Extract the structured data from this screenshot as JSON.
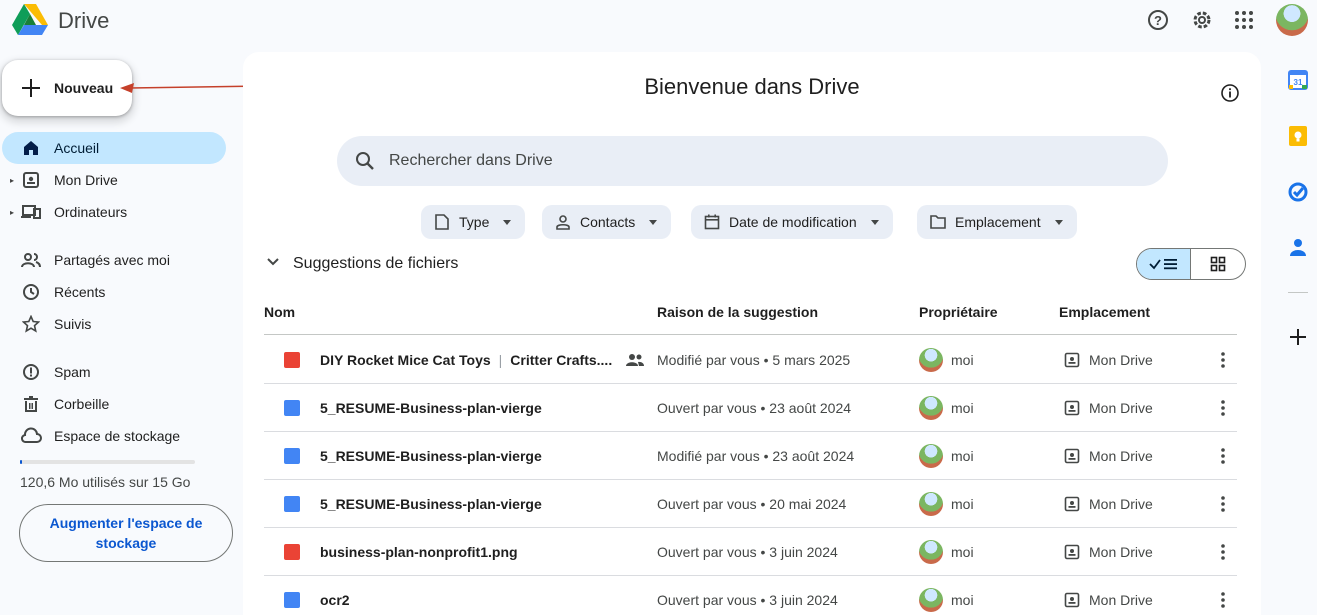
{
  "app": {
    "brand": "Drive"
  },
  "header": {
    "icons": [
      "help-icon",
      "settings-icon",
      "apps-grid-icon",
      "account-avatar"
    ]
  },
  "new_button": {
    "label": "Nouveau"
  },
  "nav": {
    "items": [
      {
        "label": "Accueil",
        "icon": "home-icon",
        "active": true
      },
      {
        "label": "Mon Drive",
        "icon": "my-drive-icon",
        "expandable": true
      },
      {
        "label": "Ordinateurs",
        "icon": "computers-icon",
        "expandable": true
      },
      {
        "label": "Partagés avec moi",
        "icon": "shared-people-icon"
      },
      {
        "label": "Récents",
        "icon": "clock-icon"
      },
      {
        "label": "Suivis",
        "icon": "star-icon"
      },
      {
        "label": "Spam",
        "icon": "spam-icon"
      },
      {
        "label": "Corbeille",
        "icon": "trash-icon"
      },
      {
        "label": "Espace de stockage",
        "icon": "cloud-icon"
      }
    ]
  },
  "storage": {
    "text": "120,6 Mo utilisés sur 15 Go",
    "used_fraction": 0.008,
    "upgrade_label": "Augmenter l'espace de stockage"
  },
  "main": {
    "title": "Bienvenue dans Drive",
    "search_placeholder": "Rechercher dans Drive",
    "filters": [
      {
        "label": "Type",
        "icon": "file-type-icon"
      },
      {
        "label": "Contacts",
        "icon": "person-icon"
      },
      {
        "label": "Date de modification",
        "icon": "calendar-icon"
      },
      {
        "label": "Emplacement",
        "icon": "folder-icon"
      }
    ],
    "section_title": "Suggestions de fichiers",
    "columns": [
      "Nom",
      "Raison de la suggestion",
      "Propriétaire",
      "Emplacement"
    ],
    "rows": [
      {
        "name": "DIY Rocket Mice Cat Toys",
        "extra": "Critter Crafts....",
        "type": "video",
        "shared": true,
        "reason": "Modifié par vous • 5 mars 2025",
        "owner": "moi",
        "location": "Mon Drive"
      },
      {
        "name": "5_RESUME-Business-plan-vierge",
        "type": "doc",
        "reason": "Ouvert par vous • 23 août 2024",
        "owner": "moi",
        "location": "Mon Drive"
      },
      {
        "name": "5_RESUME-Business-plan-vierge",
        "type": "doc",
        "reason": "Modifié par vous • 23 août 2024",
        "owner": "moi",
        "location": "Mon Drive"
      },
      {
        "name": "5_RESUME-Business-plan-vierge",
        "type": "doc",
        "reason": "Ouvert par vous • 20 mai 2024",
        "owner": "moi",
        "location": "Mon Drive"
      },
      {
        "name": "business-plan-nonprofit1.png",
        "type": "image",
        "reason": "Ouvert par vous • 3 juin 2024",
        "owner": "moi",
        "location": "Mon Drive"
      },
      {
        "name": "ocr2",
        "type": "doc",
        "reason": "Ouvert par vous • 3 juin 2024",
        "owner": "moi",
        "location": "Mon Drive"
      }
    ]
  },
  "rail": {
    "icons": [
      "calendar-app-icon",
      "keep-app-icon",
      "tasks-app-icon",
      "contacts-app-icon",
      "add-addon-icon"
    ],
    "calendar_day": "31"
  },
  "colors": {
    "accent": "#0b57d0",
    "active_nav": "#c2e7ff",
    "doc": "#4285f4",
    "video": "#ea4335",
    "image": "#ea4335"
  }
}
